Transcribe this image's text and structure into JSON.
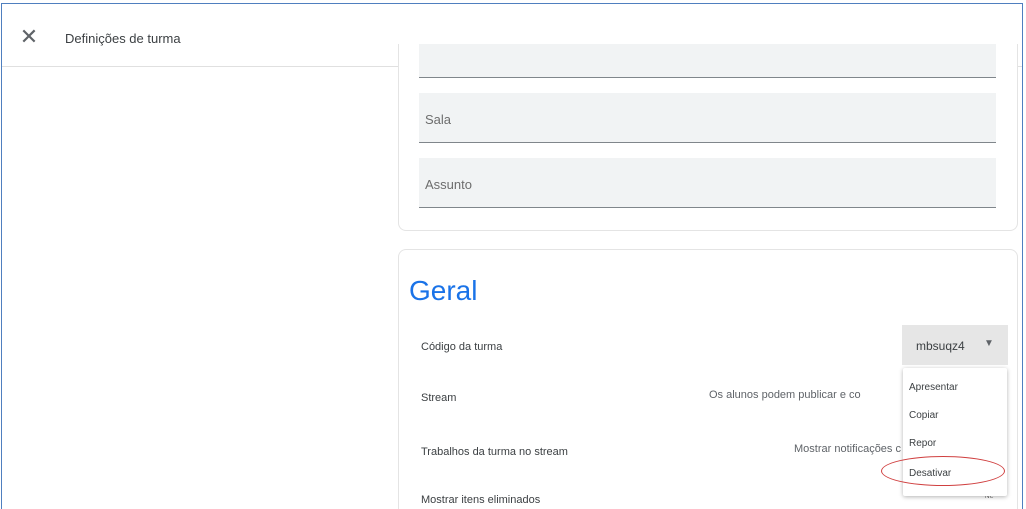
{
  "header": {
    "close_icon": "close-icon",
    "title": "Definições de turma"
  },
  "details": {
    "room_label": "Sala",
    "subject_label": "Assunto"
  },
  "general": {
    "title": "Geral",
    "class_code_label": "Código da turma",
    "class_code_value": "mbsuqz4",
    "stream_label": "Stream",
    "stream_value": "Os alunos podem publicar e co",
    "classwork_label": "Trabalhos da turma no stream",
    "classwork_value": "Mostrar notificações c",
    "deleted_label": "Mostrar itens eliminados",
    "deleted_toggle_text": "Ne"
  },
  "code_menu": {
    "items": [
      "Apresentar",
      "Copiar",
      "Repor",
      "Desativar"
    ],
    "highlighted_item": "Desativar",
    "highlight_color": "#d04040"
  },
  "colors": {
    "accent": "#1a73e8",
    "frame_border": "#4f7fbf"
  }
}
